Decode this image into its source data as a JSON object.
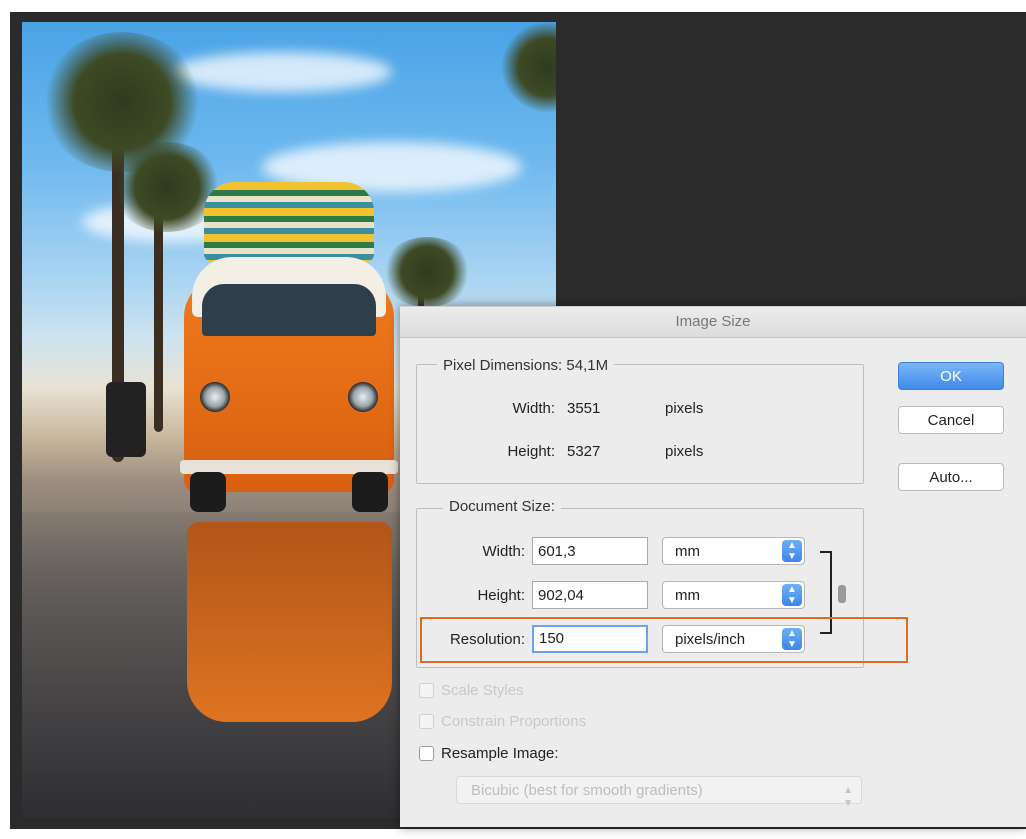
{
  "dialog": {
    "title": "Image Size",
    "pixel_dimensions": {
      "group_label": "Pixel Dimensions:",
      "size": "54,1M",
      "width_label": "Width:",
      "width_value": "3551",
      "width_unit": "pixels",
      "height_label": "Height:",
      "height_value": "5327",
      "height_unit": "pixels"
    },
    "document_size": {
      "group_label": "Document Size:",
      "width_label": "Width:",
      "width_value": "601,3",
      "width_unit": "mm",
      "height_label": "Height:",
      "height_value": "902,04",
      "height_unit": "mm",
      "resolution_label": "Resolution:",
      "resolution_value": "150",
      "resolution_unit": "pixels/inch"
    },
    "buttons": {
      "ok": "OK",
      "cancel": "Cancel",
      "auto": "Auto..."
    },
    "options": {
      "scale_styles": "Scale Styles",
      "constrain_proportions": "Constrain Proportions",
      "resample_image": "Resample Image:",
      "resample_method": "Bicubic (best for smooth gradients)"
    }
  },
  "colors": {
    "highlight": "#e06a25",
    "primary_button": "#3f89ea"
  },
  "icons": {
    "select_arrows": "up-down-chevron-icon",
    "link": "chain-link-icon"
  }
}
